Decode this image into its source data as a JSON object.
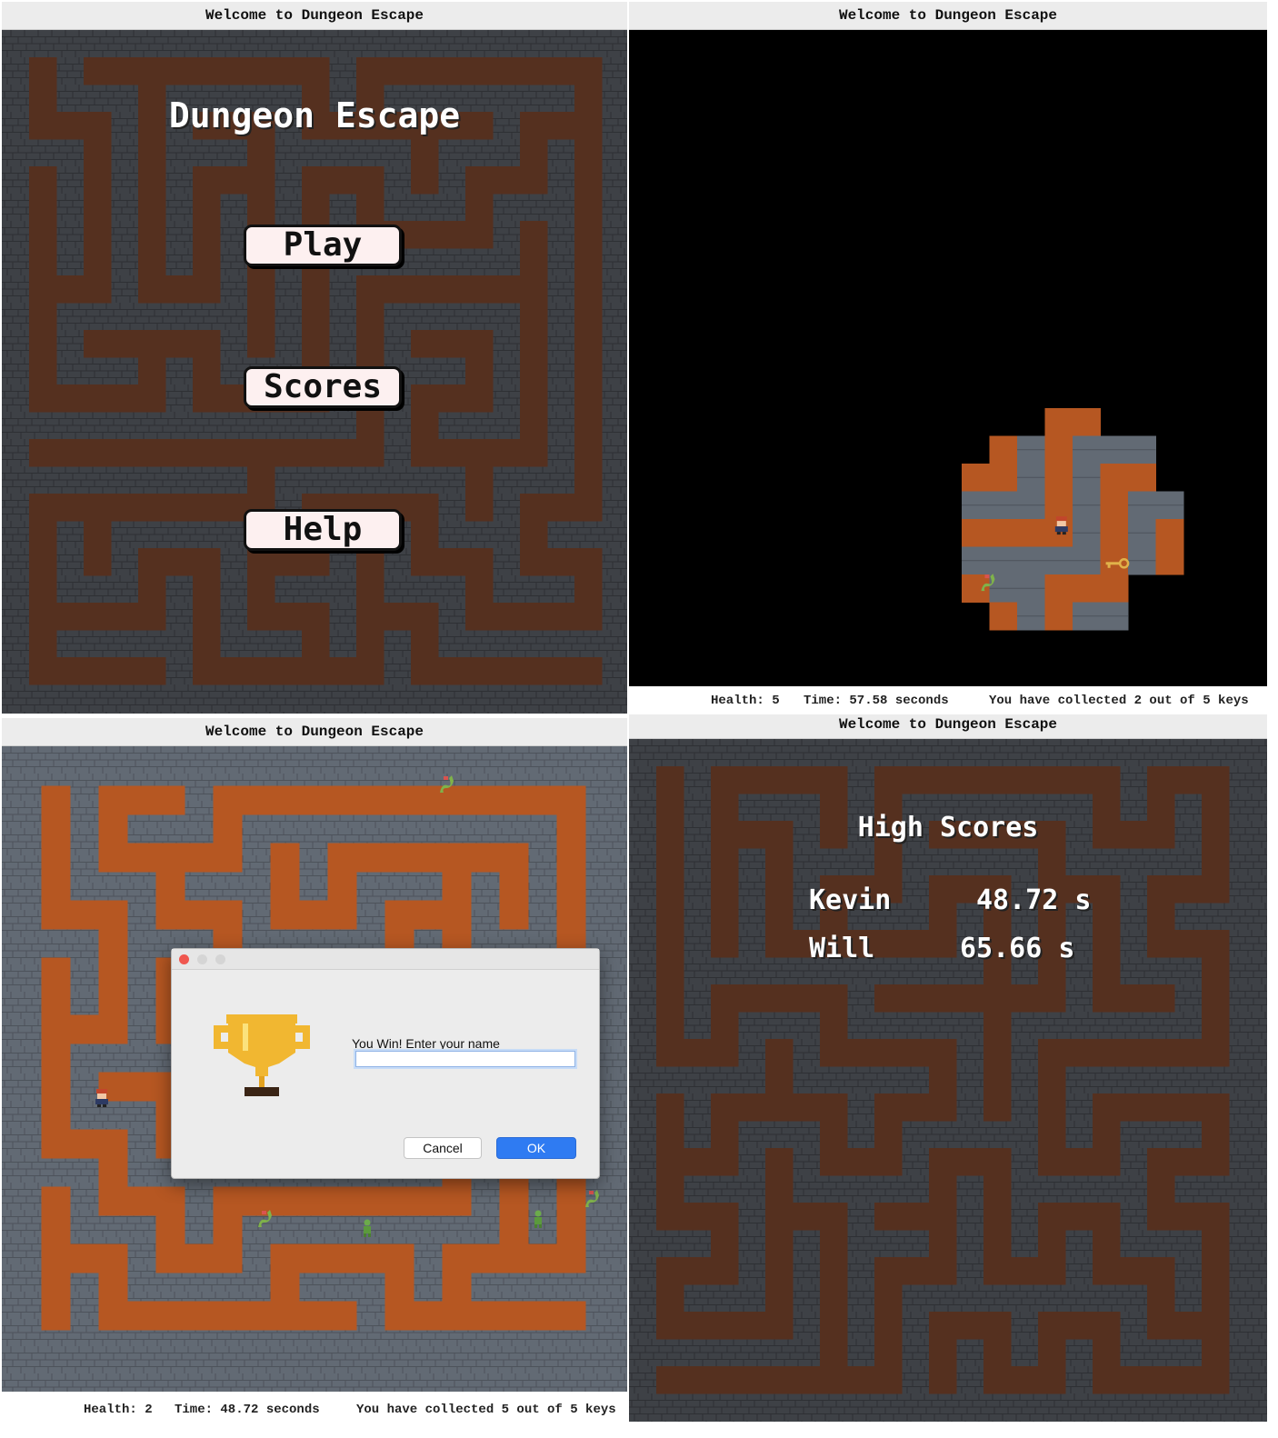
{
  "window_title": "Welcome to Dungeon Escape",
  "menu": {
    "title": "Dungeon Escape",
    "buttons": [
      "Play",
      "Scores",
      "Help"
    ]
  },
  "game_dark": {
    "status": {
      "health": "Health: 5",
      "time": "Time: 57.58 seconds",
      "keys": "You have collected 2 out of 5 keys"
    }
  },
  "game_win": {
    "dialog": {
      "message": "You Win! Enter your name",
      "input_value": "",
      "cancel_label": "Cancel",
      "ok_label": "OK"
    },
    "status": {
      "health": "Health: 2",
      "time": "Time: 48.72 seconds",
      "keys": "You have collected 5 out of 5 keys"
    }
  },
  "high_scores": {
    "title": "High Scores",
    "entries": [
      {
        "name": "Kevin",
        "score": "48.72 s"
      },
      {
        "name": "Will",
        "score": "65.66 s"
      }
    ]
  },
  "colors": {
    "dark_wall": "#3e4146",
    "dark_floor": "#55301f",
    "bright_wall": "#626a74",
    "bright_floor": "#b65722",
    "dialog_ok": "#2f7bf2",
    "trophy": "#f1b731"
  },
  "icons": [
    "trophy-icon",
    "hero-sprite",
    "dragon-sprite",
    "goblin-sprite",
    "key-icon"
  ]
}
